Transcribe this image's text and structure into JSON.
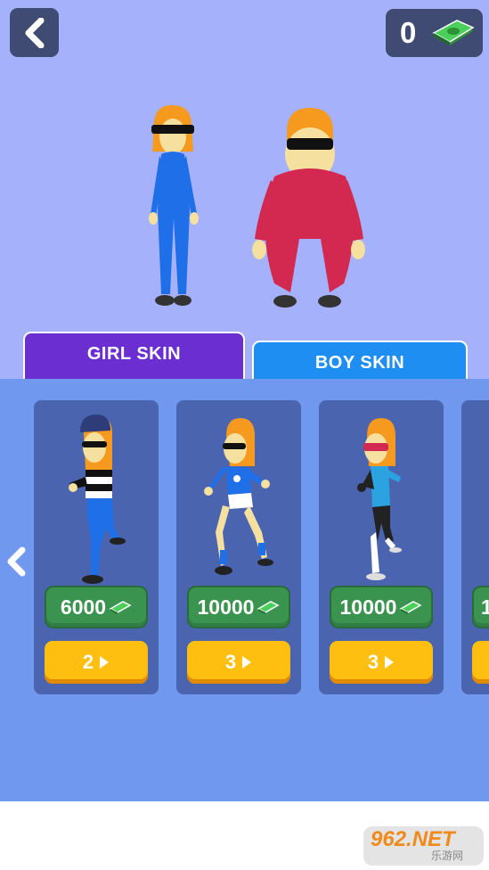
{
  "header": {
    "back_icon": "chevron-left-icon",
    "money_count": "0",
    "money_icon": "cash-stack-icon"
  },
  "characters": {
    "girl": {
      "outfit": "blue-bodysuit",
      "color": "#1f6fe8"
    },
    "boy": {
      "outfit": "red-bodysuit",
      "color": "#d3284f"
    }
  },
  "tabs": [
    {
      "label": "GIRL SKIN",
      "active": true,
      "color": "#6a2ed1"
    },
    {
      "label": "BOY SKIN",
      "active": false,
      "color": "#1e8ef3"
    }
  ],
  "carousel": {
    "prev_icon": "chevron-left-icon",
    "next_icon": "chevron-right-icon",
    "skins": [
      {
        "price": "6000",
        "ads": "2",
        "figure": "burglar-skin"
      },
      {
        "price": "10000",
        "ads": "3",
        "figure": "soccer-skin"
      },
      {
        "price": "10000",
        "ads": "3",
        "figure": "ninja-skin"
      },
      {
        "price": "1",
        "ads": "",
        "figure": "partial-skin"
      }
    ]
  },
  "watermark": {
    "main": "962.NET",
    "sub": "乐游网"
  },
  "colors": {
    "sky": "#a6b1fb",
    "panel": "#6f98ee",
    "card": "#4a64b0",
    "price_green": "#3a9450",
    "ad_yellow": "#ffbf10"
  }
}
